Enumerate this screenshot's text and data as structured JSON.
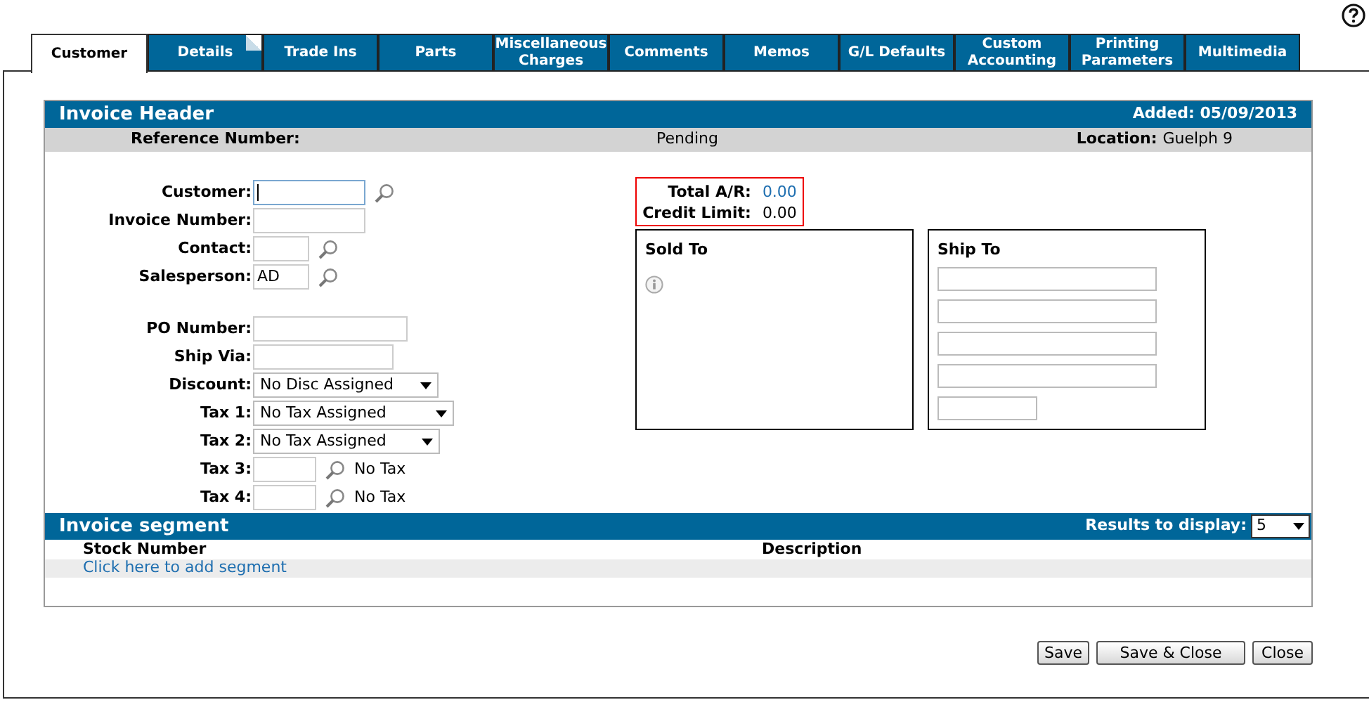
{
  "tabs": [
    {
      "label": "Customer",
      "selected": true,
      "dog_ear": false
    },
    {
      "label": "Details",
      "selected": false,
      "dog_ear": true
    },
    {
      "label": "Trade Ins",
      "selected": false,
      "dog_ear": false
    },
    {
      "label": "Parts",
      "selected": false,
      "dog_ear": false
    },
    {
      "label": "Miscellaneous Charges",
      "selected": false,
      "dog_ear": false
    },
    {
      "label": "Comments",
      "selected": false,
      "dog_ear": false
    },
    {
      "label": "Memos",
      "selected": false,
      "dog_ear": false
    },
    {
      "label": "G/L Defaults",
      "selected": false,
      "dog_ear": false
    },
    {
      "label": "Custom Accounting",
      "selected": false,
      "dog_ear": false
    },
    {
      "label": "Printing Parameters",
      "selected": false,
      "dog_ear": false
    },
    {
      "label": "Multimedia",
      "selected": false,
      "dog_ear": false
    }
  ],
  "header": {
    "title": "Invoice Header",
    "added": "Added: 05/09/2013"
  },
  "info_row": {
    "reference_label": "Reference Number:",
    "status": "Pending",
    "location_label": "Location:",
    "location": "Guelph 9"
  },
  "customer_fields": [
    {
      "label": "Customer:",
      "kind": "lookup",
      "focused": true
    },
    {
      "label": "Invoice Number:",
      "kind": "text",
      "focused": false
    },
    {
      "label": "Contact:",
      "kind": "lookup",
      "focused": false
    },
    {
      "label": "Salesperson:",
      "kind": "lookup",
      "value": "AD",
      "focused": false
    }
  ],
  "order_fields": [
    {
      "label": "PO Number:",
      "kind": "text"
    },
    {
      "label": "Ship Via:",
      "kind": "text"
    },
    {
      "label": "Discount:",
      "kind": "select",
      "value": "No Disc Assigned"
    },
    {
      "label": "Tax 1:",
      "kind": "select",
      "value": "No Tax Assigned"
    },
    {
      "label": "Tax 2:",
      "kind": "select",
      "value": "No Tax Assigned"
    },
    {
      "label": "Tax 3:",
      "kind": "lookup",
      "note": "No Tax"
    },
    {
      "label": "Tax 4:",
      "kind": "lookup",
      "note": "No Tax"
    }
  ],
  "account": {
    "total_ar_label": "Total A/R:",
    "total_ar": "0.00",
    "credit_limit_label": "Credit Limit:",
    "credit_limit": "0.00"
  },
  "sold_to": {
    "title": "Sold To"
  },
  "ship_to": {
    "title": "Ship To"
  },
  "segment": {
    "title": "Invoice segment",
    "results_label": "Results to display:",
    "results_value": "5",
    "columns": [
      "Stock Number",
      "Description"
    ],
    "add_link": "Click here to add segment"
  },
  "buttons": [
    "Save",
    "Save & Close",
    "Close"
  ]
}
